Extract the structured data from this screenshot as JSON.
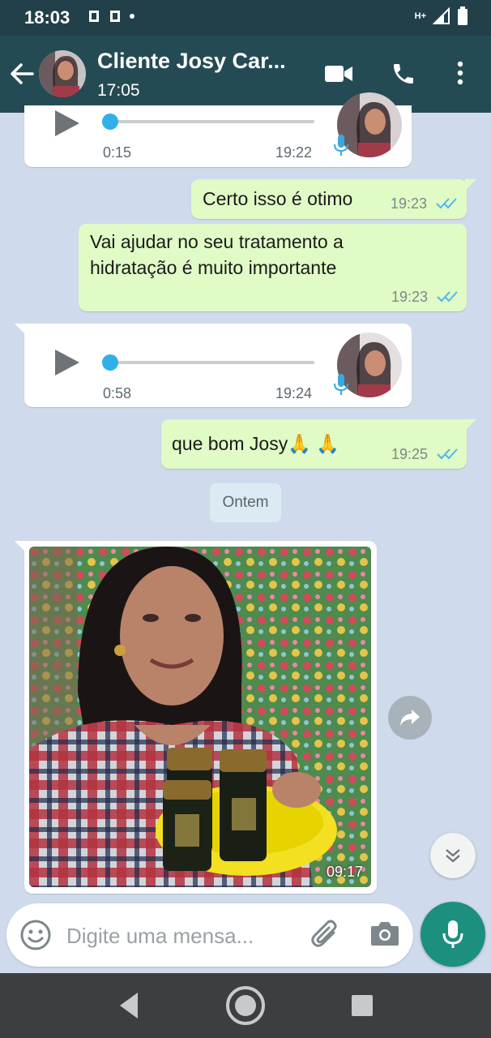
{
  "status_bar": {
    "time": "18:03",
    "network": "H+"
  },
  "header": {
    "contact_name": "Cliente Josy Car...",
    "last_seen": "17:05"
  },
  "messages": [
    {
      "type": "audio",
      "direction": "incoming",
      "duration": "0:15",
      "time": "19:22",
      "progress": 0
    },
    {
      "type": "text",
      "direction": "outgoing",
      "text": "Certo isso é otimo",
      "time": "19:23",
      "status": "read"
    },
    {
      "type": "text",
      "direction": "outgoing",
      "text_line1": "Vai ajudar no seu tratamento a",
      "text_line2": "hidratação é muito importante",
      "time": "19:23",
      "status": "read"
    },
    {
      "type": "audio",
      "direction": "incoming",
      "duration": "0:58",
      "time": "19:24",
      "progress": 0
    },
    {
      "type": "text",
      "direction": "outgoing",
      "text": "que bom  Josy🙏 🙏",
      "time": "19:25",
      "status": "read"
    },
    {
      "type": "date_separator",
      "label": "Ontem"
    },
    {
      "type": "image",
      "direction": "incoming",
      "time": "09:17"
    }
  ],
  "composer": {
    "placeholder": "Digite uma mensa..."
  },
  "colors": {
    "header": "#244b54",
    "outgoing_bubble": "#e0fbc6",
    "incoming_bubble": "#ffffff",
    "chat_bg": "#cfdbec",
    "mic_button": "#1c8f7e",
    "read_ticks": "#4fb6ec"
  }
}
